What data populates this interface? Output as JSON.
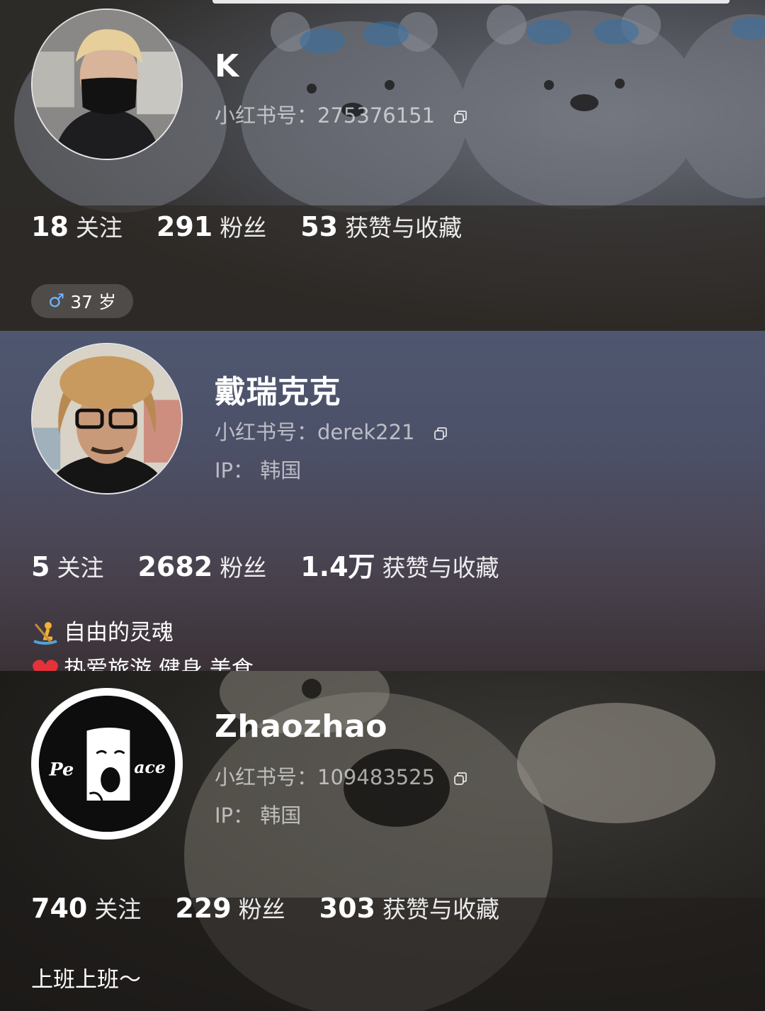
{
  "profiles": [
    {
      "name": "K",
      "id_label": "小红书号：",
      "id_value": "275376151",
      "following": {
        "num": "18",
        "label": "关注"
      },
      "followers": {
        "num": "291",
        "label": "粉丝"
      },
      "likes": {
        "num": "53",
        "label": "获赞与收藏"
      },
      "tag": {
        "gender_icon": "♂",
        "text": "37 岁"
      }
    },
    {
      "name": "戴瑞克克",
      "id_label": "小红书号：",
      "id_value": "derek221",
      "ip": "IP：  韩国",
      "following": {
        "num": "5",
        "label": "关注"
      },
      "followers": {
        "num": "2682",
        "label": "粉丝"
      },
      "likes": {
        "num": "1.4万",
        "label": "获赞与收藏"
      },
      "bio_line1": "自由的灵魂",
      "bio_line2": "热爱旅游   健身   美食"
    },
    {
      "name": "Zhaozhao",
      "id_label": "小红书号：",
      "id_value": "109483525",
      "ip": "IP：  韩国",
      "following": {
        "num": "740",
        "label": "关注"
      },
      "followers": {
        "num": "229",
        "label": "粉丝"
      },
      "likes": {
        "num": "303",
        "label": "获赞与收藏"
      },
      "bio": "上班上班～",
      "avatar_text_left": "Pe",
      "avatar_text_right": "ace"
    }
  ],
  "icons": {
    "copy": "copy-icon",
    "gender": "male-gender-icon",
    "bio_emoji_1": "rowing-person-icon",
    "bio_emoji_2": "red-heart-icon"
  },
  "colors": {
    "gender_blue": "#6fb4ff",
    "heart_red": "#e5323a"
  }
}
